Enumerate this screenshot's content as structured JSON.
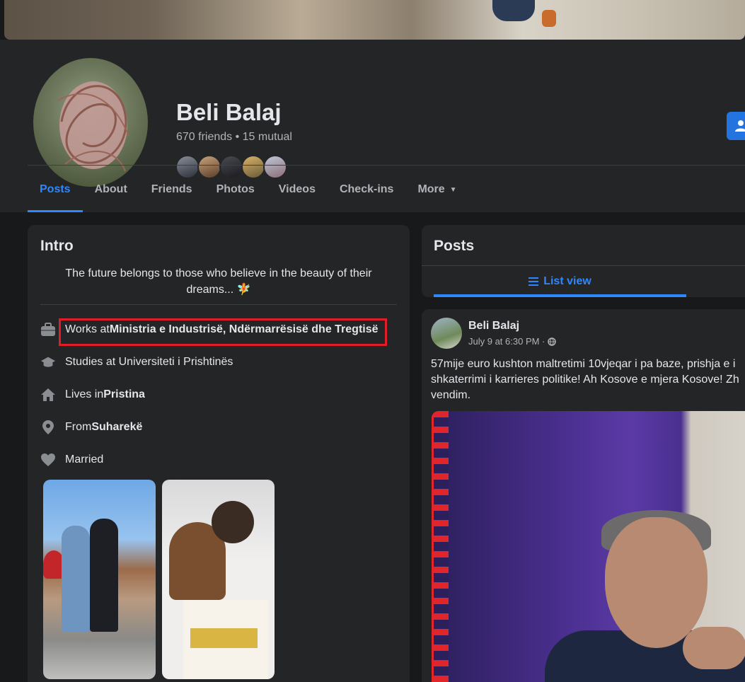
{
  "profile": {
    "name": "Beli Balaj",
    "friends_summary": "670 friends • 15 mutual"
  },
  "tabs": [
    {
      "label": "Posts"
    },
    {
      "label": "About"
    },
    {
      "label": "Friends"
    },
    {
      "label": "Photos"
    },
    {
      "label": "Videos"
    },
    {
      "label": "Check-ins"
    },
    {
      "label": "More"
    }
  ],
  "intro": {
    "title": "Intro",
    "bio": "The future belongs to those who believe in the beauty of their dreams... 🧚",
    "items": [
      {
        "icon": "briefcase-icon",
        "prefix": "Works at ",
        "value": "Ministria e Industrisë, Ndërmarrësisë dhe Tregtisë"
      },
      {
        "icon": "graduation-cap-icon",
        "prefix": "Studies at Universiteti i Prishtinës",
        "value": ""
      },
      {
        "icon": "home-icon",
        "prefix": "Lives in ",
        "value": "Pristina"
      },
      {
        "icon": "location-pin-icon",
        "prefix": "From ",
        "value": "Suharekë"
      },
      {
        "icon": "heart-icon",
        "prefix": "Married",
        "value": ""
      }
    ]
  },
  "posts_section": {
    "title": "Posts",
    "list_view_label": "List view"
  },
  "post": {
    "author": "Beli Balaj",
    "timestamp": "July 9 at 6:30 PM ·",
    "text": "57mije euro kushton maltretimi 10vjeqar i pa baze, prishja e i\nshkaterrimi i karrieres politike! Ah Kosove e mjera Kosove! Zh\nvendim."
  },
  "colors": {
    "accent": "#2d88ff",
    "highlight_box": "#e11d2a",
    "card_bg": "#242526",
    "page_bg": "#18191a"
  }
}
